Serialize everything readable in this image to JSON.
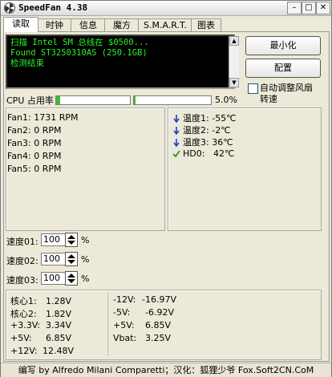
{
  "window": {
    "title": "SpeedFan 4.38"
  },
  "tabs": [
    {
      "label": "读取"
    },
    {
      "label": "时钟"
    },
    {
      "label": "信息"
    },
    {
      "label": "魔方"
    },
    {
      "label": "S.M.A.R.T."
    },
    {
      "label": "图表"
    }
  ],
  "log": {
    "lines": [
      "扫描 Intel SM 总线在 $0500...",
      "Found ST3250310AS (250.1GB)",
      "检测结束"
    ]
  },
  "buttons": {
    "minimize": "最小化",
    "config": "配置"
  },
  "auto_fan": {
    "label_line1": "自动调整风扇",
    "label_line2": "转速"
  },
  "cpu": {
    "label": "CPU 占用率",
    "percent": "5.0%",
    "usage_fraction": 0.05
  },
  "fans": [
    {
      "label": "Fan1:",
      "value": "1731 RPM"
    },
    {
      "label": "Fan2:",
      "value": "0 RPM"
    },
    {
      "label": "Fan3:",
      "value": "0 RPM"
    },
    {
      "label": "Fan4:",
      "value": "0 RPM"
    },
    {
      "label": "Fan5:",
      "value": "0 RPM"
    }
  ],
  "temps": [
    {
      "label": "温度1:",
      "value": "-55℃",
      "icon": "arrow-down-icon"
    },
    {
      "label": "温度2:",
      "value": "-2℃",
      "icon": "arrow-down-icon"
    },
    {
      "label": "温度3:",
      "value": "36℃",
      "icon": "arrow-down-icon"
    },
    {
      "label": "HD0:",
      "value": "42℃",
      "icon": "checkmark-icon"
    }
  ],
  "speeds": [
    {
      "label": "速度01:",
      "value": "100",
      "unit": "%"
    },
    {
      "label": "速度02:",
      "value": "100",
      "unit": "%"
    },
    {
      "label": "速度03:",
      "value": "100",
      "unit": "%"
    }
  ],
  "voltages_left": [
    {
      "label": "核心1:",
      "value": "1.28V"
    },
    {
      "label": "核心2:",
      "value": "1.82V"
    },
    {
      "label": "+3.3V:",
      "value": "3.34V"
    },
    {
      "label": "+5V:",
      "value": "6.85V"
    },
    {
      "label": "+12V:",
      "value": "12.48V"
    }
  ],
  "voltages_right": [
    {
      "label": "-12V:",
      "value": "-16.97V"
    },
    {
      "label": "-5V:",
      "value": "-6.92V"
    },
    {
      "label": "+5V:",
      "value": "6.85V"
    },
    {
      "label": "Vbat:",
      "value": "3.25V"
    }
  ],
  "footer": {
    "text": "编写 by Alfredo Milani Comparetti；汉化：狐狸少爷 Fox.Soft2CN.CoM"
  },
  "colors": {
    "log_text": "#2cf02c",
    "arrow": "#1a3fd0",
    "check": "#1e9a1e",
    "cpu_fill": "#3cbc3c"
  }
}
